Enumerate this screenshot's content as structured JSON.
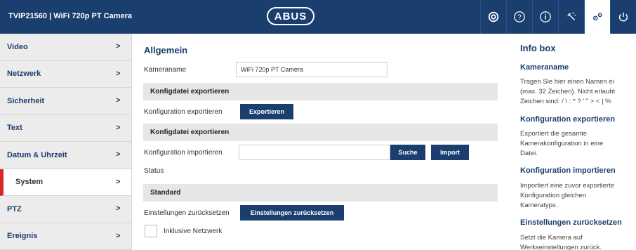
{
  "header": {
    "title": "TVIP21560 | WiFi 720p PT Camera",
    "logo": "ABUS",
    "icons": [
      "live-view-icon",
      "help-icon",
      "info-icon",
      "wizard-icon",
      "settings-icon",
      "power-icon"
    ]
  },
  "sidebar": {
    "items": [
      {
        "label": "Video",
        "chevron": ">"
      },
      {
        "label": "Netzwerk",
        "chevron": ">"
      },
      {
        "label": "Sicherheit",
        "chevron": ">"
      },
      {
        "label": "Text",
        "chevron": ">"
      },
      {
        "label": "Datum & Uhrzeit",
        "chevron": ">"
      },
      {
        "label": "System",
        "chevron": ">"
      },
      {
        "label": "PTZ",
        "chevron": ">"
      },
      {
        "label": "Ereignis",
        "chevron": ">"
      }
    ],
    "active": "System"
  },
  "main": {
    "heading": "Allgemein",
    "camera_name_label": "Kameraname",
    "camera_name_value": "WiFi 720p PT Camera",
    "section_export": "Konfigdatei exportieren",
    "export_label": "Konfiguration exportieren",
    "export_button": "Exportieren",
    "section_import": "Konfigdatei exportieren",
    "import_label": "Konfiguration importieren",
    "import_file_value": "",
    "search_button": "Suche",
    "import_button": "Import",
    "status_label": "Status",
    "section_standard": "Standard",
    "reset_label": "Einstellungen zurücksetzen",
    "reset_button": "Einstellungen zurücksetzen",
    "include_network_label": "Inklusive Netzwerk"
  },
  "info": {
    "title": "Info box",
    "h_camera_name": "Kameraname",
    "p_camera_name_1": "Tragen Sie hier einen Namen ei",
    "p_camera_name_2": "(max. 32 Zeichen). Nicht erlaubt",
    "p_camera_name_3": "Zeichen sind: / \\ : * ? ' \" > < | %",
    "h_export": "Konfiguration exportieren",
    "p_export_1": "Exportiert die gesamte",
    "p_export_2": "Kamerakonfiguration in eine",
    "p_export_3": "Datei.",
    "h_import": "Konfiguration importieren",
    "p_import_1": "Importiert eine zuvor exportierte",
    "p_import_2": "Konfiguration gleichen",
    "p_import_3": "Kameratyps.",
    "h_reset": "Einstellungen zurücksetzen",
    "p_reset_1": "Setzt die Kamera auf",
    "p_reset_2": "Werkseinstellungen zurück."
  }
}
